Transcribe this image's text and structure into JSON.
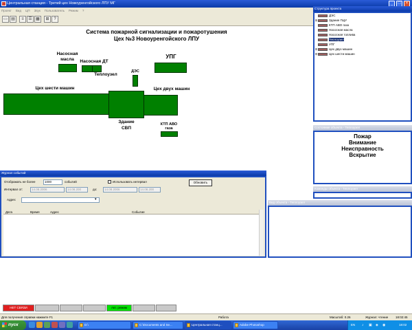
{
  "window": {
    "title": "Центральная станция - Третий цех Новоуренгойского ЛПУ МГ",
    "menu": [
      "Проект",
      "Вид",
      "ЦП",
      "Звук",
      "Пользователь",
      "Режим",
      "?"
    ],
    "controls": {
      "minimize": "_",
      "maximize": "□",
      "close": "×"
    }
  },
  "toolbar": {
    "buttons": [
      {
        "icon": "open-icon",
        "glyph": "▭"
      },
      {
        "icon": "print-icon",
        "glyph": "▤"
      },
      {
        "icon": "list-icon",
        "glyph": "≡"
      },
      {
        "icon": "list-details-icon",
        "glyph": "☰"
      },
      {
        "icon": "grid-icon",
        "glyph": "▦"
      },
      {
        "icon": "config-icon",
        "glyph": "⊞"
      },
      {
        "icon": "help-icon",
        "glyph": "?"
      }
    ]
  },
  "diagram": {
    "title_line1": "Система пожарной сигнализации и пожаротушения",
    "title_line2": "Цех №3 Новоуренгойского ЛПУ",
    "labels": {
      "pump_oil_1": "Насосная",
      "pump_oil_2": "масла",
      "pump_dt": "Насосная ДТ",
      "teplouzel": "Теплоузел",
      "des": "ДЭС",
      "upg": "УПГ",
      "shop6": "Цех шести машин",
      "shop2": "Цех двух машин",
      "svp_1": "Здание",
      "svp_2": "СВП",
      "ktp_1": "КТП АВО",
      "ktp_2": "газа"
    },
    "colors": {
      "object_ok": "#008000"
    }
  },
  "tree_panel": {
    "title": "Структура проекта",
    "items": [
      {
        "label": "ДЭС",
        "expandable": false,
        "selected": false
      },
      {
        "label": "Здание ГЩУ",
        "expandable": true,
        "selected": false
      },
      {
        "label": "КТП АВО газа",
        "expandable": false,
        "selected": false
      },
      {
        "label": "Насосная масла",
        "expandable": false,
        "selected": false
      },
      {
        "label": "Насосная топлива",
        "expandable": false,
        "selected": false
      },
      {
        "label": "Теплоузел",
        "expandable": false,
        "selected": true
      },
      {
        "label": "УПГ",
        "expandable": false,
        "selected": false
      },
      {
        "label": "Цех двух машин",
        "expandable": true,
        "selected": false
      },
      {
        "label": "Цех шести машин",
        "expandable": true,
        "selected": false
      }
    ]
  },
  "state_panel": {
    "title": "Состояние объекта - Теплоузел",
    "states": [
      "Пожар",
      "Внимание",
      "Неисправность",
      "Вскрытие"
    ]
  },
  "commands_panel": {
    "title": "Команды объекта - Теплоузел"
  },
  "view_panel": {
    "title": "Вид объекта - Теплоузел"
  },
  "journal": {
    "title": "Журнал событий",
    "show_label": "Отображать не более",
    "show_value": "1000",
    "show_unit": "событий",
    "use_interval_label": "Использовать интервал",
    "refresh_button": "Обновить",
    "interval_from_label": "Интервал от:",
    "interval_to_label": "до:",
    "date_from": "14.08.2006",
    "time_from": "14.08.200",
    "date_to": "14.08.2006",
    "time_to": "14.08.200",
    "address_label": "Адрес",
    "address_value": "",
    "columns": [
      "Дата",
      "Время",
      "Адрес",
      "Событие"
    ]
  },
  "indicators": [
    {
      "label": "НЕТ СВЯЗИ",
      "color": "#e02020",
      "text_color": "#ffffff"
    },
    {
      "label": "",
      "color": "#c9c9c9",
      "text_color": "#000000"
    },
    {
      "label": "",
      "color": "#c9c9c9",
      "text_color": "#000000"
    },
    {
      "label": "",
      "color": "#c9c9c9",
      "text_color": "#000000"
    },
    {
      "label": "Авт. режим",
      "color": "#00e000",
      "text_color": "#000000"
    },
    {
      "label": "",
      "color": "#c9c9c9",
      "text_color": "#000000"
    },
    {
      "label": "",
      "color": "#c9c9c9",
      "text_color": "#000000"
    }
  ],
  "statusbar": {
    "hint": "Для получения справки нажмите  F1",
    "mode": "Работа",
    "scale": "Масштаб: 0.26",
    "journal_read": "Журнал: чтение",
    "time": "18:02:45"
  },
  "taskbar": {
    "start": "пуск",
    "tasks": [
      {
        "label": "D:\\",
        "active": false
      },
      {
        "label": "C:\\Documents and Se...",
        "active": false
      },
      {
        "label": "Центральная станц...",
        "active": true
      },
      {
        "label": "Adobe Photoshop",
        "active": false
      }
    ],
    "lang": "EN",
    "clock": "18:02"
  }
}
